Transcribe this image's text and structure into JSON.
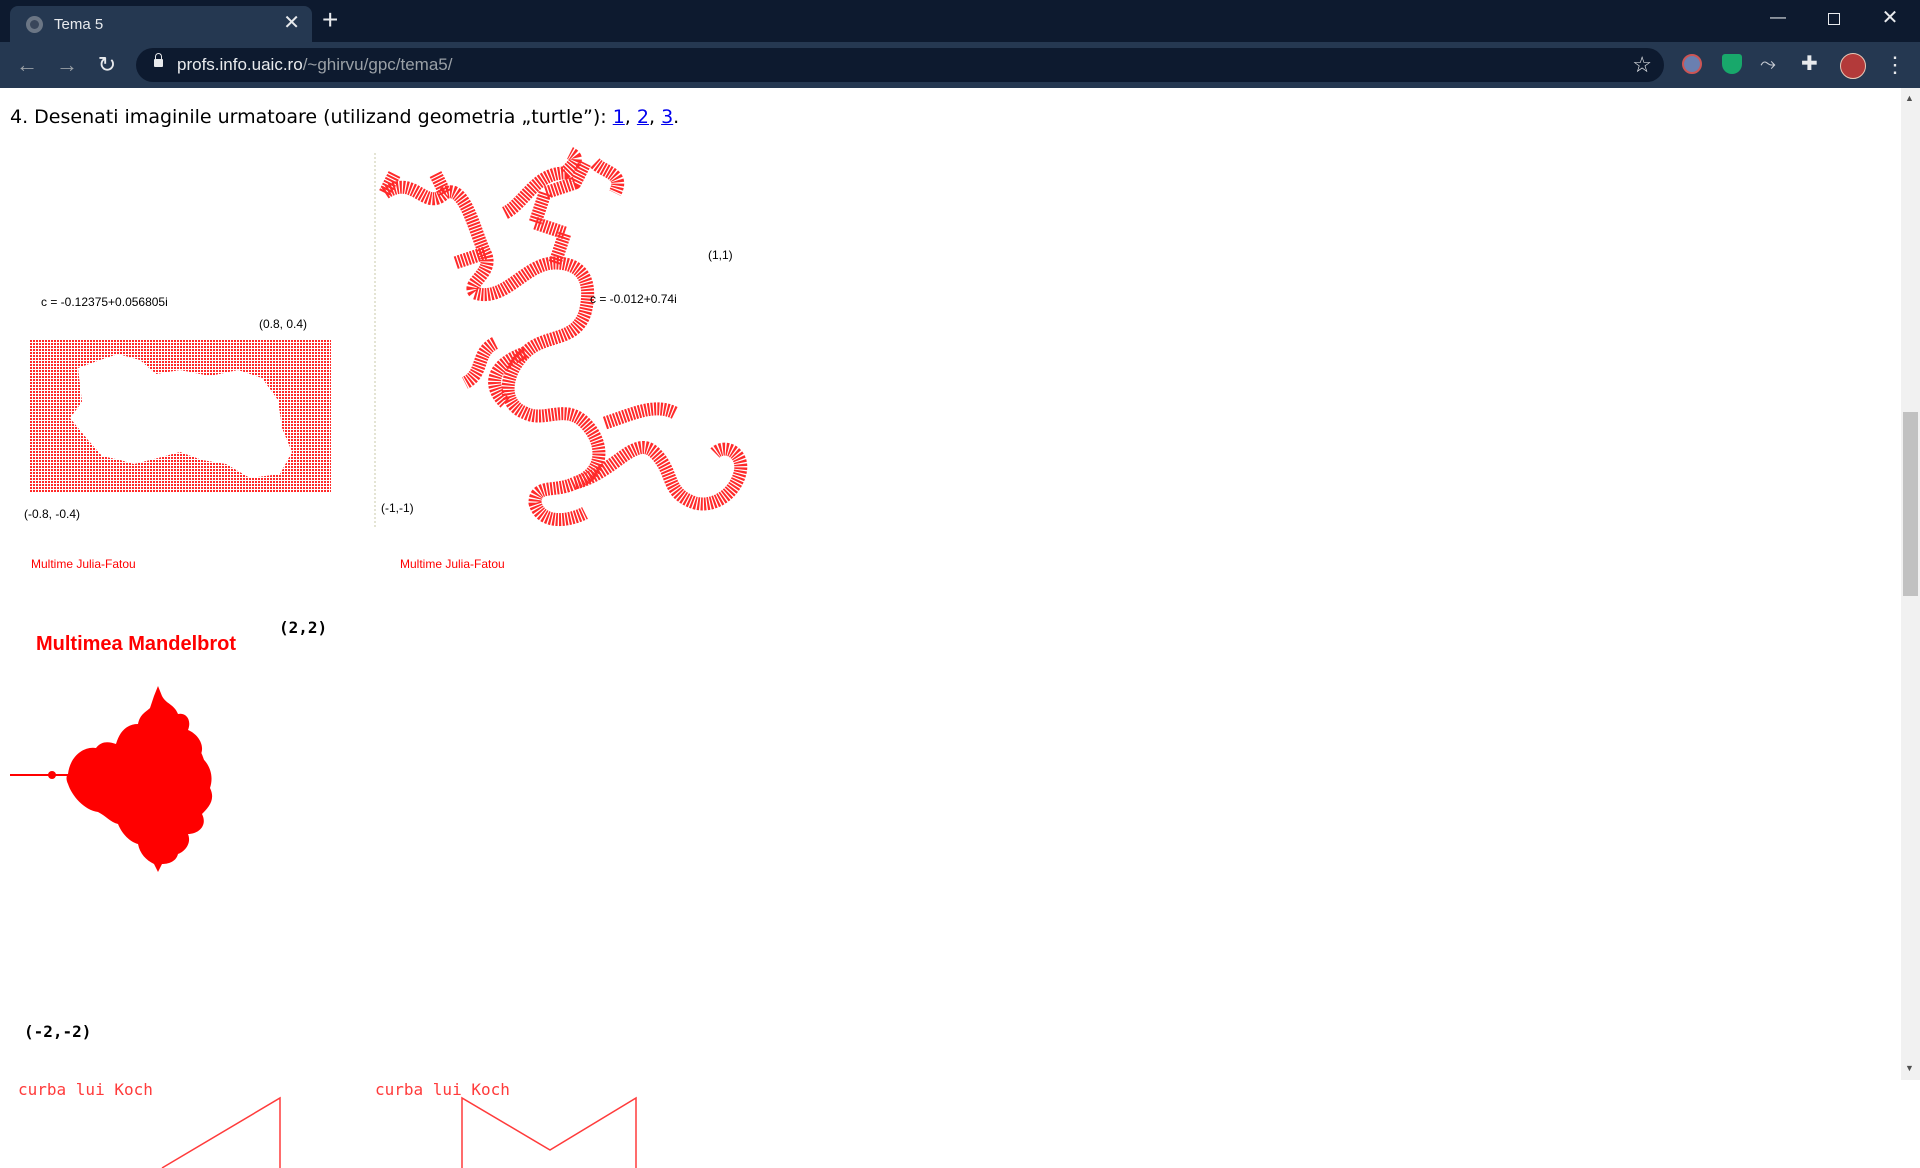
{
  "browser": {
    "tab_title": "Tema 5",
    "tab_close": "✕",
    "new_tab": "+",
    "url_host": "profs.info.uaic.ro",
    "url_path": "/~ghirvu/gpc/tema5/",
    "window_min": "—",
    "window_close": "✕"
  },
  "page": {
    "heading_prefix": "4. Desenati imaginile urmatoare (utilizand geometria „turtle”): ",
    "links": [
      "1",
      "2",
      "3"
    ],
    "sep1": ", ",
    "sep2": ", ",
    "heading_suffix": "."
  },
  "figures": {
    "julia1": {
      "c_label": "c = -0.12375+0.056805i",
      "top_right": "(0.8, 0.4)",
      "bottom_left": "(-0.8, -0.4)",
      "caption": "Multime Julia-Fatou"
    },
    "julia2": {
      "top_right": "(1,1)",
      "c_label": "c = -0.012+0.74i",
      "bottom_left": "(-1,-1)",
      "caption": "Multime Julia-Fatou"
    },
    "mandelbrot": {
      "title": "Multimea Mandelbrot",
      "top_right": "(2,2)",
      "bottom_left": "(-2,-2)"
    },
    "koch1": {
      "caption": "curba lui Koch"
    },
    "koch2": {
      "caption": "curba lui Koch"
    }
  },
  "colors": {
    "fractal_red": "#ff0000",
    "link_blue": "#0000ee",
    "chrome_dark": "#0d1a2f",
    "chrome_tab": "#253851"
  }
}
